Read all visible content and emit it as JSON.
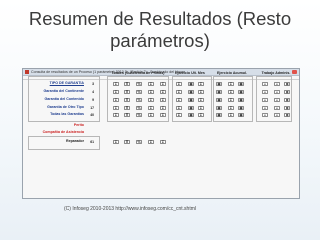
{
  "slide": {
    "title_line1": "Resumen de Resultados (Resto",
    "title_line2": "parámetros)",
    "footer": "(C) Infoseg 2010-2013 http://www.infoseg.com/cc_cnt.shtml"
  },
  "window": {
    "title": "Consulta de resultados de un Proceso (1 parámetro) 2010 3 - (Partida 2) - Combinado del Hogar"
  },
  "sections": {
    "totales": "Totales (Suficiencia de Primas)",
    "ejercicio": "Ejercicio Ult. Mes",
    "acumul": "Ejercicio Acumul.",
    "trabajo": "Trabajo Adminis."
  },
  "rows": [
    {
      "label": "TIPO DE GARANTIA",
      "count": "3",
      "style": "sel"
    },
    {
      "label": "Garantía del Continente",
      "count": "4",
      "style": "blue"
    },
    {
      "label": "Garantía del Contenido",
      "count": "9",
      "style": "blue"
    },
    {
      "label": "Garantía de Otro Tipo",
      "count": "17",
      "style": "blue"
    },
    {
      "label": "Todas las Garantías",
      "count": "40",
      "style": "blue"
    },
    {
      "label": "Perito",
      "count": "",
      "style": "red"
    },
    {
      "label": "Compañía de Asistencia",
      "count": "",
      "style": "red"
    },
    {
      "label": "Reparador",
      "count": "61",
      "style": "dark"
    }
  ],
  "button_glyphs": {
    "sum": "Σ",
    "prod": "Π",
    "pct": "%",
    "eye": "◉",
    "dot": "●",
    "save": "⊞"
  }
}
